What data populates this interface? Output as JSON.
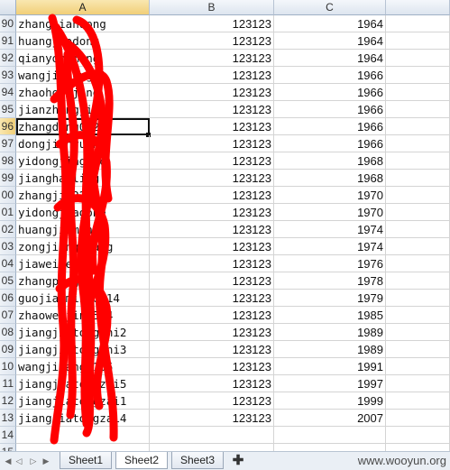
{
  "columns": [
    "A",
    "B",
    "C"
  ],
  "selected_column": "A",
  "rows": [
    {
      "num": "90",
      "a": "zhangjiandong",
      "b": "123123",
      "c": "1964"
    },
    {
      "num": "91",
      "a": "huangjiadong",
      "b": "123123",
      "c": "1964"
    },
    {
      "num": "92",
      "a": "qianyongming",
      "b": "123123",
      "c": "1964"
    },
    {
      "num": "93",
      "a": "wangjiadong81",
      "b": "123123",
      "c": "1966"
    },
    {
      "num": "94",
      "a": "zhaohongjing",
      "b": "123123",
      "c": "1966"
    },
    {
      "num": "95",
      "a": "jianzhongjiao",
      "b": "123123",
      "c": "1966"
    },
    {
      "num": "96",
      "a": "zhangdong0225",
      "b": "123123",
      "c": "1966"
    },
    {
      "num": "97",
      "a": "dongjianyuan",
      "b": "123123",
      "c": "1966"
    },
    {
      "num": "98",
      "a": "yidongjiagone",
      "b": "123123",
      "c": "1968"
    },
    {
      "num": "99",
      "a": "jianghailing",
      "b": "123123",
      "c": "1968"
    },
    {
      "num": "00",
      "a": "zhangjia225",
      "b": "123123",
      "c": "1970"
    },
    {
      "num": "01",
      "a": "yidongjiagone",
      "b": "123123",
      "c": "1970"
    },
    {
      "num": "02",
      "a": "huangjiaming",
      "b": "123123",
      "c": "1974"
    },
    {
      "num": "03",
      "a": "zongjiangliang",
      "b": "123123",
      "c": "1974"
    },
    {
      "num": "04",
      "a": "jiaweiwei09",
      "b": "123123",
      "c": "1976"
    },
    {
      "num": "05",
      "a": "zhangpeng25",
      "b": "123123",
      "c": "1978"
    },
    {
      "num": "06",
      "a": "guojianming0514",
      "b": "123123",
      "c": "1979"
    },
    {
      "num": "07",
      "a": "zhaowenjing524",
      "b": "123123",
      "c": "1985"
    },
    {
      "num": "08",
      "a": "jiangjiatongzhi2",
      "b": "123123",
      "c": "1989"
    },
    {
      "num": "09",
      "a": "jiangjiatongzhi3",
      "b": "123123",
      "c": "1989"
    },
    {
      "num": "10",
      "a": "wangjiyang1105",
      "b": "123123",
      "c": "1991"
    },
    {
      "num": "11",
      "a": "jiangjiatongzhi5",
      "b": "123123",
      "c": "1997"
    },
    {
      "num": "12",
      "a": "jiangjiatongzai1",
      "b": "123123",
      "c": "1999"
    },
    {
      "num": "13",
      "a": "jiangjiatongzai4",
      "b": "123123",
      "c": "2007"
    },
    {
      "num": "14",
      "a": "",
      "b": "",
      "c": ""
    },
    {
      "num": "15",
      "a": "",
      "b": "",
      "c": ""
    }
  ],
  "sheet_tabs": [
    "Sheet1",
    "Sheet2",
    "Sheet3"
  ],
  "active_sheet": "Sheet2",
  "add_sheet_icon": "plus-icon",
  "watermark": "www.wooyun.org",
  "redaction_color": "#ff0000"
}
